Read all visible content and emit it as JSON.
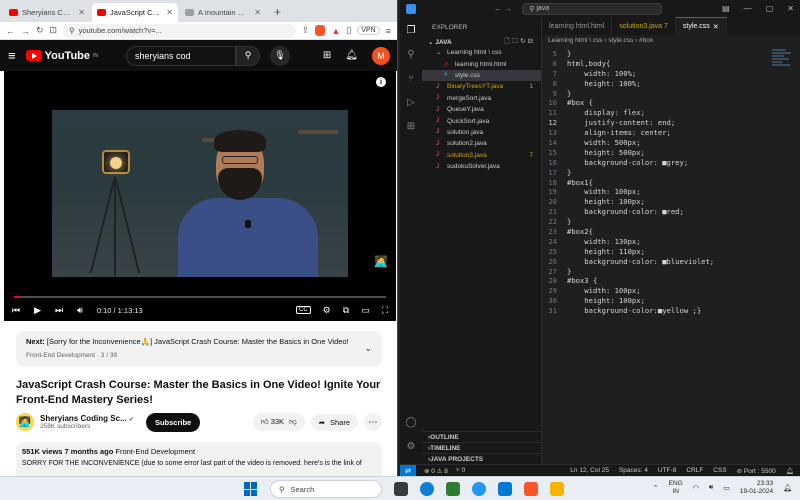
{
  "browser": {
    "tabs": [
      {
        "title": "Sheryians Coding Scho",
        "active": false
      },
      {
        "title": "JavaScript Crash Co",
        "active": true
      },
      {
        "title": "A mountain with stars i",
        "active": false
      }
    ],
    "new_tab": "+",
    "url": "youtube.com/watch?v=...",
    "vpn": "VPN"
  },
  "youtube": {
    "logo": "YouTube",
    "logo_region": "IN",
    "search_query": "sheryians cod",
    "avatar_letter": "M",
    "player": {
      "time": "0:10 / 1:13:13",
      "progress_fraction": 0.002,
      "cc_label": "CC"
    },
    "next": {
      "prefix": "Next:",
      "title": "[Sorry for the Inconvenience🙏] JavaScript Crash Course: Master the Basics in One Video!",
      "playlist": "Front-End Development · 3 / 39"
    },
    "video_title": "JavaScript Crash Course: Master the Basics in One Video! Ignite Your Front-End Mastery Series!",
    "channel": {
      "name": "Sheryians Coding Sc...",
      "verified": "✔",
      "subscribers": "258K subscribers",
      "subscribe_label": "Subscribe"
    },
    "actions": {
      "likes": "33K",
      "share": "Share",
      "more": "⋯"
    },
    "description": {
      "views": "551K views",
      "ago": "7 months ago",
      "tag": "Front-End Development",
      "text": "SORRY FOR THE INCONVENIENCE (due to some error last part of the video is removed. here's is the link of"
    }
  },
  "vscode": {
    "command_center": "java",
    "explorer_label": "EXPLORER",
    "project": "JAVA",
    "files": [
      {
        "name": "Learning html \\ css",
        "kind": "folder",
        "indent": 1,
        "selected": false,
        "warn": false,
        "badge": ""
      },
      {
        "name": "learning html.html",
        "kind": "html",
        "indent": 2,
        "selected": false,
        "warn": false,
        "badge": ""
      },
      {
        "name": "style.css",
        "kind": "css",
        "indent": 2,
        "selected": true,
        "warn": false,
        "badge": ""
      },
      {
        "name": "BinaryTreesYT.java",
        "kind": "java",
        "indent": 1,
        "selected": false,
        "warn": true,
        "badge": "1"
      },
      {
        "name": "mergeSort.java",
        "kind": "java",
        "indent": 1,
        "selected": false,
        "warn": false,
        "badge": ""
      },
      {
        "name": "QueueY.java",
        "kind": "java",
        "indent": 1,
        "selected": false,
        "warn": false,
        "badge": ""
      },
      {
        "name": "QuickSort.java",
        "kind": "java",
        "indent": 1,
        "selected": false,
        "warn": false,
        "badge": ""
      },
      {
        "name": "solution.java",
        "kind": "java",
        "indent": 1,
        "selected": false,
        "warn": false,
        "badge": ""
      },
      {
        "name": "solution2.java",
        "kind": "java",
        "indent": 1,
        "selected": false,
        "warn": false,
        "badge": ""
      },
      {
        "name": "solution3.java",
        "kind": "java",
        "indent": 1,
        "selected": false,
        "warn": true,
        "badge": "7"
      },
      {
        "name": "sudokuSolver.java",
        "kind": "java",
        "indent": 1,
        "selected": false,
        "warn": false,
        "badge": ""
      }
    ],
    "bottom_sections": [
      "OUTLINE",
      "TIMELINE",
      "JAVA PROJECTS"
    ],
    "editor_tabs": [
      {
        "label": "learning html.html",
        "active": false,
        "warn": false
      },
      {
        "label": "solution3.java 7",
        "active": false,
        "warn": true
      },
      {
        "label": "style.css",
        "active": true,
        "warn": false
      }
    ],
    "breadcrumb": "Learning html \\ css  ›  style.css  ›  #box",
    "current_line": 12,
    "code_lines": [
      {
        "n": 5,
        "t": "}"
      },
      {
        "n": 6,
        "t": "html,body{"
      },
      {
        "n": 7,
        "t": "    width: 100%;"
      },
      {
        "n": 8,
        "t": "    height: 100%;"
      },
      {
        "n": 9,
        "t": "}"
      },
      {
        "n": 10,
        "t": "#box {"
      },
      {
        "n": 11,
        "t": "    display: flex;"
      },
      {
        "n": 12,
        "t": "    justify-content: end;"
      },
      {
        "n": 13,
        "t": "    align-items: center;"
      },
      {
        "n": 14,
        "t": "    width: 500px;"
      },
      {
        "n": 15,
        "t": "    height: 500px;"
      },
      {
        "n": 16,
        "t": "    background-color: ■grey;"
      },
      {
        "n": 17,
        "t": "}"
      },
      {
        "n": 18,
        "t": "#box1{"
      },
      {
        "n": 19,
        "t": "    width: 100px;"
      },
      {
        "n": 20,
        "t": "    height: 100px;"
      },
      {
        "n": 21,
        "t": "    background-color: ■red;"
      },
      {
        "n": 22,
        "t": "}"
      },
      {
        "n": 23,
        "t": "#box2{"
      },
      {
        "n": 24,
        "t": "    width: 130px;"
      },
      {
        "n": 25,
        "t": "    height: 110px;"
      },
      {
        "n": 26,
        "t": "    background-color: ■blueviolet;"
      },
      {
        "n": 27,
        "t": "}"
      },
      {
        "n": 28,
        "t": "#box3 {"
      },
      {
        "n": 29,
        "t": "    width: 100px;"
      },
      {
        "n": 30,
        "t": "    height: 100px;"
      },
      {
        "n": 31,
        "t": "    background-color:■yellow ;}"
      }
    ],
    "status": {
      "errors": "⊗ 0 ⚠ 8",
      "ports": "⑂ 0",
      "position": "Ln 12, Col 25",
      "spaces": "Spaces: 4",
      "encoding": "UTF-8",
      "eol": "CRLF",
      "language": "CSS",
      "port": "⊘ Port : 5500"
    }
  },
  "taskbar": {
    "search_placeholder": "Search",
    "lang_top": "ENG",
    "lang_bottom": "IN",
    "time": "23:33",
    "date": "19-01-2024"
  },
  "colors": {
    "yt_red": "#ff0000",
    "vs_accent": "#0078d4",
    "warn": "#cca700"
  }
}
